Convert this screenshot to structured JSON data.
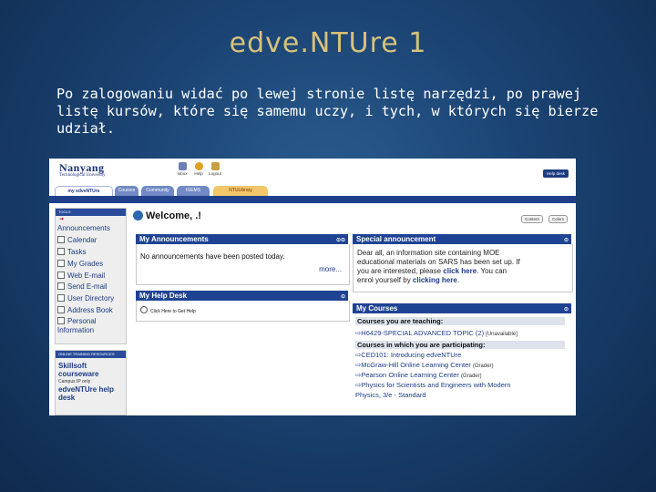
{
  "slide": {
    "title": "edve.NTUre 1",
    "body": "Po zalogowaniu widać po lewej stronie listę narzędzi, po prawej listę kursów, które się samemu uczy, i tych, w których się bierze udział."
  },
  "screenshot": {
    "logo": {
      "name": "Nanyang",
      "subtitle": "Technological University"
    },
    "toolbar": {
      "inbox": "Inbox",
      "help": "Help",
      "logout": "Logout"
    },
    "helpdesk_button": "Help desk",
    "tabs": [
      "my edveNTUre",
      "Courses",
      "Community",
      "IGEMS",
      "NTULibrary"
    ],
    "sidebar": {
      "header": "TOOLS",
      "items": [
        "Announcements",
        "Calendar",
        "Tasks",
        "My Grades",
        "Web E-mail",
        "Send E-mail",
        "User Directory",
        "Address Book",
        "Personal Information"
      ]
    },
    "support_box": {
      "header": "ONLINE TRAINING RESOURCES",
      "item1": "Skillsoft courseware",
      "item1_note": "Campus IP only",
      "item2": "edveNTUre help desk"
    },
    "welcome": "Welcome, .!",
    "buttons": {
      "content": "Content",
      "colors": "Colors"
    },
    "my_announcements": {
      "title": "My Announcements",
      "text": "No announcements have been posted today.",
      "more": "more..."
    },
    "my_help_desk": {
      "title": "My Help Desk",
      "link": "Click Here to Get Help"
    },
    "special_announcement": {
      "title": "Special announcement",
      "line1": "Dear all, an information site containing MOE",
      "line2": "educational materials on SARS has been set up. If",
      "line3_pre": "you are interested, please ",
      "line3_link": "click here",
      "line3_post": ". You can",
      "line4_pre": "enrol yourself by ",
      "line4_link": "clicking here",
      "line4_post": "."
    },
    "my_courses": {
      "title": "My Courses",
      "teaching_header": "Courses you are teaching:",
      "teaching": [
        {
          "name": "H6429-SPECIAL ADVANCED TOPIC (2)",
          "tag": "[Unavailable]"
        }
      ],
      "participating_header": "Courses in which you are participating:",
      "participating": [
        {
          "name": "CED101: Introducing edveNTUre",
          "tag": ""
        },
        {
          "name": "McGraw-Hill Online Learning Center",
          "tag": "(Grader)"
        },
        {
          "name": "Pearson Online Learning Center",
          "tag": "(Grader)"
        },
        {
          "name": "Physics for Scientists and Engineers with Modern",
          "tag": ""
        },
        {
          "name": "Physics, 3/e - Standard",
          "tag": ""
        }
      ]
    }
  }
}
